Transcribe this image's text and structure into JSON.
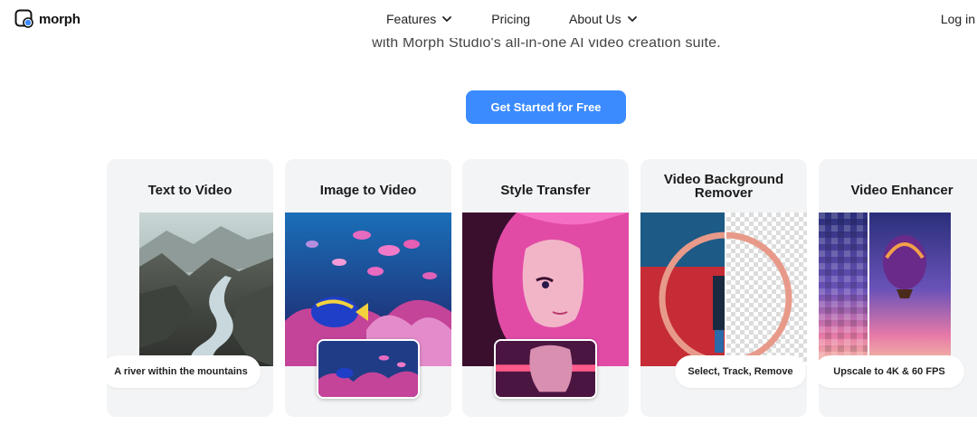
{
  "nav": {
    "brand": "morph",
    "links": [
      {
        "label": "Features",
        "has_dropdown": true
      },
      {
        "label": "Pricing",
        "has_dropdown": false
      },
      {
        "label": "About Us",
        "has_dropdown": true
      }
    ],
    "login": "Log in"
  },
  "hero": {
    "subtitle": "with Morph Studio's all-in-one AI video creation suite.",
    "cta": "Get Started for Free"
  },
  "colors": {
    "accent": "#3b8bff",
    "card_bg": "#f3f4f6"
  },
  "cards": [
    {
      "title": "Text to Video",
      "caption": "A river within the mountains"
    },
    {
      "title": "Image to Video"
    },
    {
      "title": "Style Transfer"
    },
    {
      "title": "Video Background Remover",
      "caption": "Select, Track, Remove"
    },
    {
      "title": "Video Enhancer",
      "caption": "Upscale to 4K & 60 FPS"
    }
  ]
}
